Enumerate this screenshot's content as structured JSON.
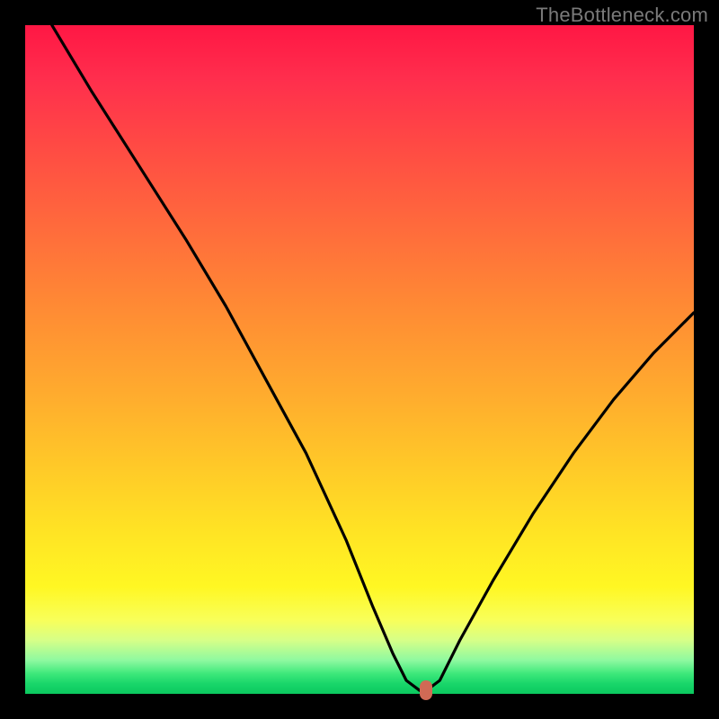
{
  "watermark": "TheBottleneck.com",
  "colors": {
    "background": "#000000",
    "gradient_top": "#ff1744",
    "gradient_mid1": "#ff8a34",
    "gradient_mid2": "#ffe424",
    "gradient_bottom": "#0bc95f",
    "curve": "#000000",
    "marker": "#d06a55",
    "watermark_text": "#7a7a7a"
  },
  "chart_data": {
    "type": "line",
    "title": "",
    "xlabel": "",
    "ylabel": "",
    "xlim": [
      0,
      100
    ],
    "ylim": [
      0,
      100
    ],
    "series": [
      {
        "name": "bottleneck-curve",
        "x": [
          4,
          10,
          17,
          24,
          30,
          36,
          42,
          48,
          52,
          55,
          57,
          59,
          60,
          62,
          65,
          70,
          76,
          82,
          88,
          94,
          100
        ],
        "y": [
          100,
          90,
          79,
          68,
          58,
          47,
          36,
          23,
          13,
          6,
          2,
          0.5,
          0.5,
          2,
          8,
          17,
          27,
          36,
          44,
          51,
          57
        ]
      }
    ],
    "marker": {
      "x": 60,
      "y": 0.5
    },
    "annotations": []
  }
}
